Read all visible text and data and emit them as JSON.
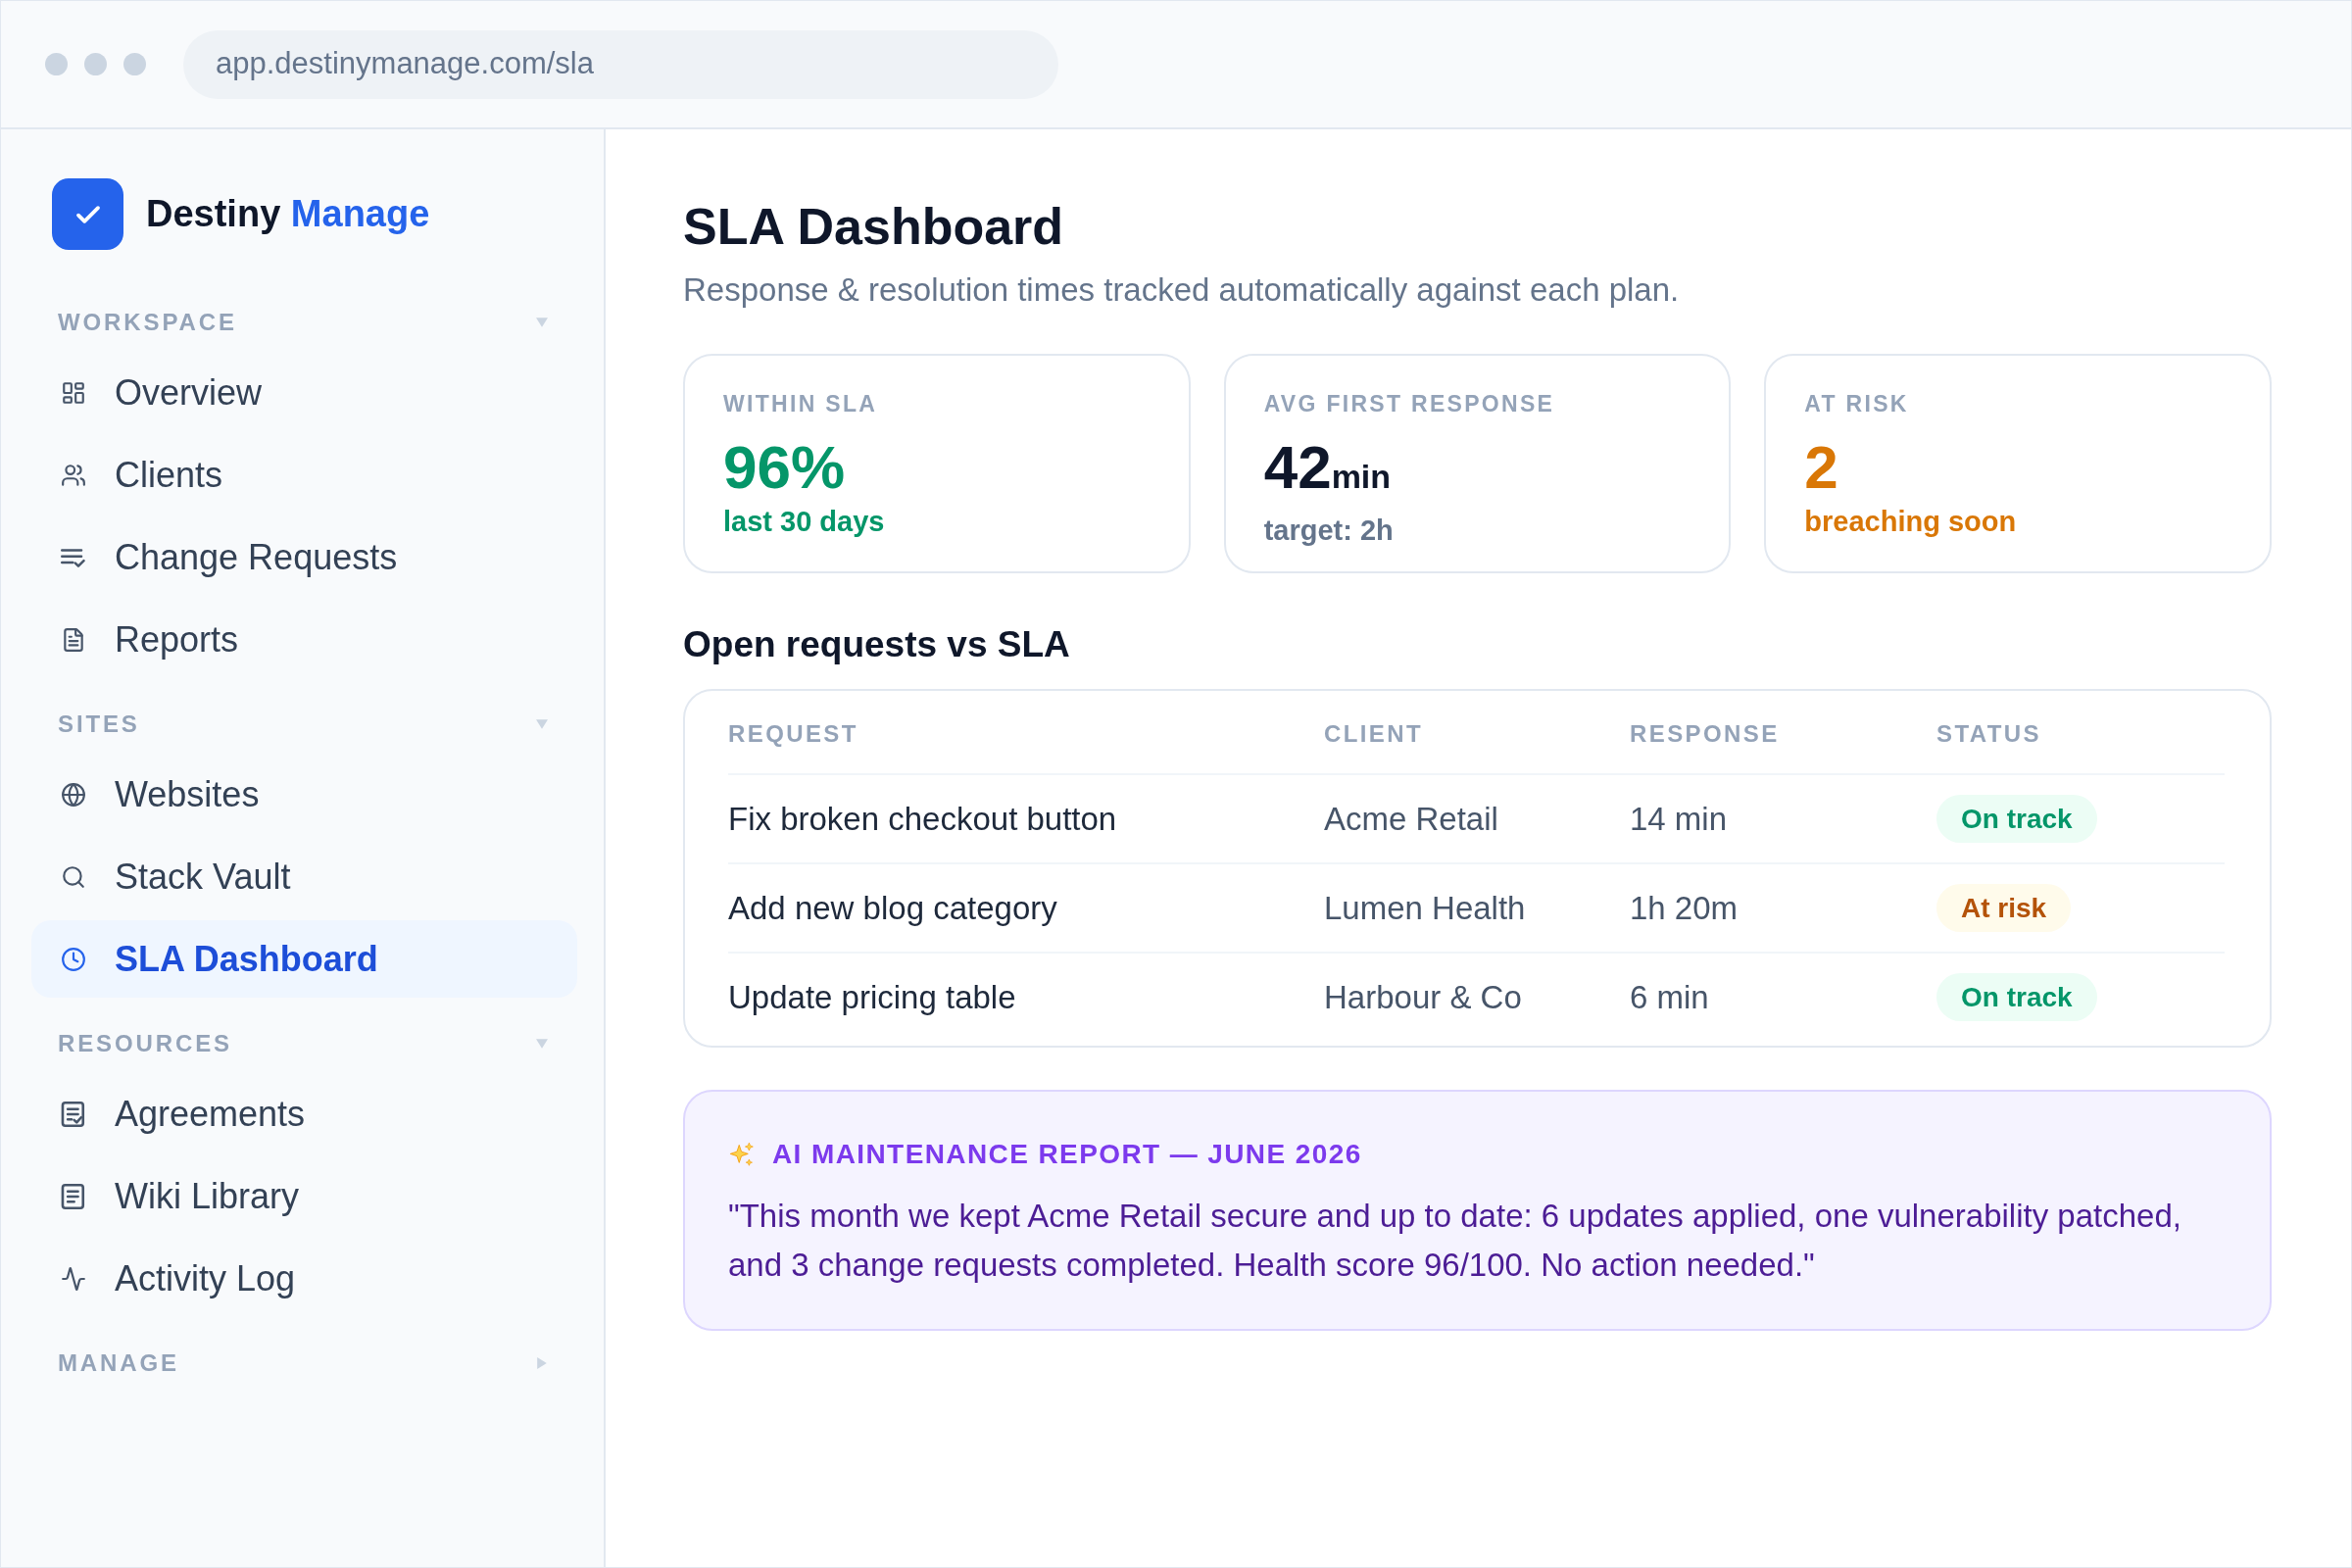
{
  "browser": {
    "url": "app.destinymanage.com/sla"
  },
  "sidebar": {
    "brand": {
      "name": "Destiny",
      "accent": "Manage"
    },
    "sections": [
      {
        "title": "WORKSPACE",
        "expanded": true,
        "items": [
          {
            "label": "Overview",
            "selected": false
          },
          {
            "label": "Clients",
            "selected": false
          },
          {
            "label": "Change Requests",
            "selected": false
          },
          {
            "label": "Reports",
            "selected": false
          }
        ]
      },
      {
        "title": "SITES",
        "expanded": true,
        "items": [
          {
            "label": "Websites",
            "selected": false
          },
          {
            "label": "Stack Vault",
            "selected": false
          },
          {
            "label": "SLA Dashboard",
            "selected": true
          }
        ]
      },
      {
        "title": "RESOURCES",
        "expanded": true,
        "items": [
          {
            "label": "Agreements",
            "selected": false
          },
          {
            "label": "Wiki Library",
            "selected": false
          },
          {
            "label": "Activity Log",
            "selected": false
          }
        ]
      },
      {
        "title": "MANAGE",
        "expanded": false
      }
    ]
  },
  "page": {
    "title": "SLA Dashboard",
    "subtitle": "Response & resolution times tracked automatically against each plan."
  },
  "stats": [
    {
      "label": "WITHIN SLA",
      "value": "96%",
      "note": "last 30 days",
      "kind": "good"
    },
    {
      "label": "AVG FIRST RESPONSE",
      "value": "42",
      "unit": "min",
      "note": "target: 2h",
      "kind": "neutral"
    },
    {
      "label": "AT RISK",
      "value": "2",
      "note": "breaching soon",
      "kind": "warning"
    }
  ],
  "table": {
    "title": "Open requests vs SLA",
    "columns": [
      "REQUEST",
      "CLIENT",
      "RESPONSE",
      "STATUS"
    ],
    "rows": [
      {
        "request": "Fix broken checkout button",
        "client": "Acme Retail",
        "response": "14 min",
        "status": {
          "label": "On track",
          "kind": "on_track"
        }
      },
      {
        "request": "Add new blog category",
        "client": "Lumen Health",
        "response": "1h 20m",
        "status": {
          "label": "At risk",
          "kind": "at_risk"
        }
      },
      {
        "request": "Update pricing table",
        "client": "Harbour & Co",
        "response": "6 min",
        "status": {
          "label": "On track",
          "kind": "on_track"
        }
      }
    ]
  },
  "report": {
    "title": "AI MAINTENANCE REPORT — JUNE 2026",
    "body": "\"This month we kept Acme Retail secure and up to date: 6 updates applied, one vulnerability patched, and 3 change requests completed. Health score 96/100. No action needed.\""
  }
}
